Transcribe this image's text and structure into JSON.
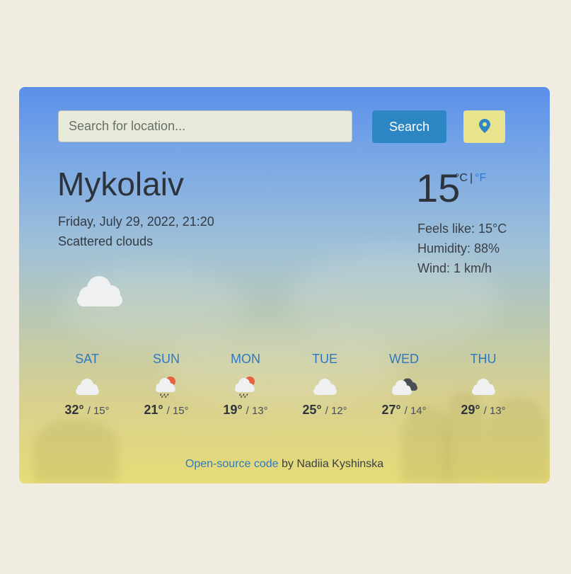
{
  "search": {
    "placeholder": "Search for location...",
    "button_label": "Search"
  },
  "location_button": {
    "icon": "map-pin-icon"
  },
  "current": {
    "city": "Mykolaiv",
    "date": "Friday, July 29, 2022, 21:20",
    "description": "Scattered clouds",
    "icon": "cloud-icon",
    "temperature": "15",
    "unit_c": "°C",
    "separator": "|",
    "unit_f": "°F",
    "feels_like": "Feels like: 15°C",
    "humidity": "Humidity: 88%",
    "wind": "Wind: 1 km/h"
  },
  "forecast": [
    {
      "day": "SAT",
      "icon": "cloud-icon",
      "high": "32°",
      "low": "/ 15°"
    },
    {
      "day": "SUN",
      "icon": "sun-rain-cloud-icon",
      "high": "21°",
      "low": "/ 15°"
    },
    {
      "day": "MON",
      "icon": "sun-rain-cloud-icon",
      "high": "19°",
      "low": "/ 13°"
    },
    {
      "day": "TUE",
      "icon": "cloud-icon",
      "high": "25°",
      "low": "/ 12°"
    },
    {
      "day": "WED",
      "icon": "dark-clouds-icon",
      "high": "27°",
      "low": "/ 14°"
    },
    {
      "day": "THU",
      "icon": "cloud-icon",
      "high": "29°",
      "low": "/ 13°"
    }
  ],
  "footer": {
    "link_text": "Open-source code",
    "suffix": " by Nadiia Kyshinska"
  },
  "colors": {
    "accent": "#2b86c3",
    "location_button": "#e8e48e",
    "link": "#2f78c0",
    "page_bg": "#f0ece1"
  }
}
